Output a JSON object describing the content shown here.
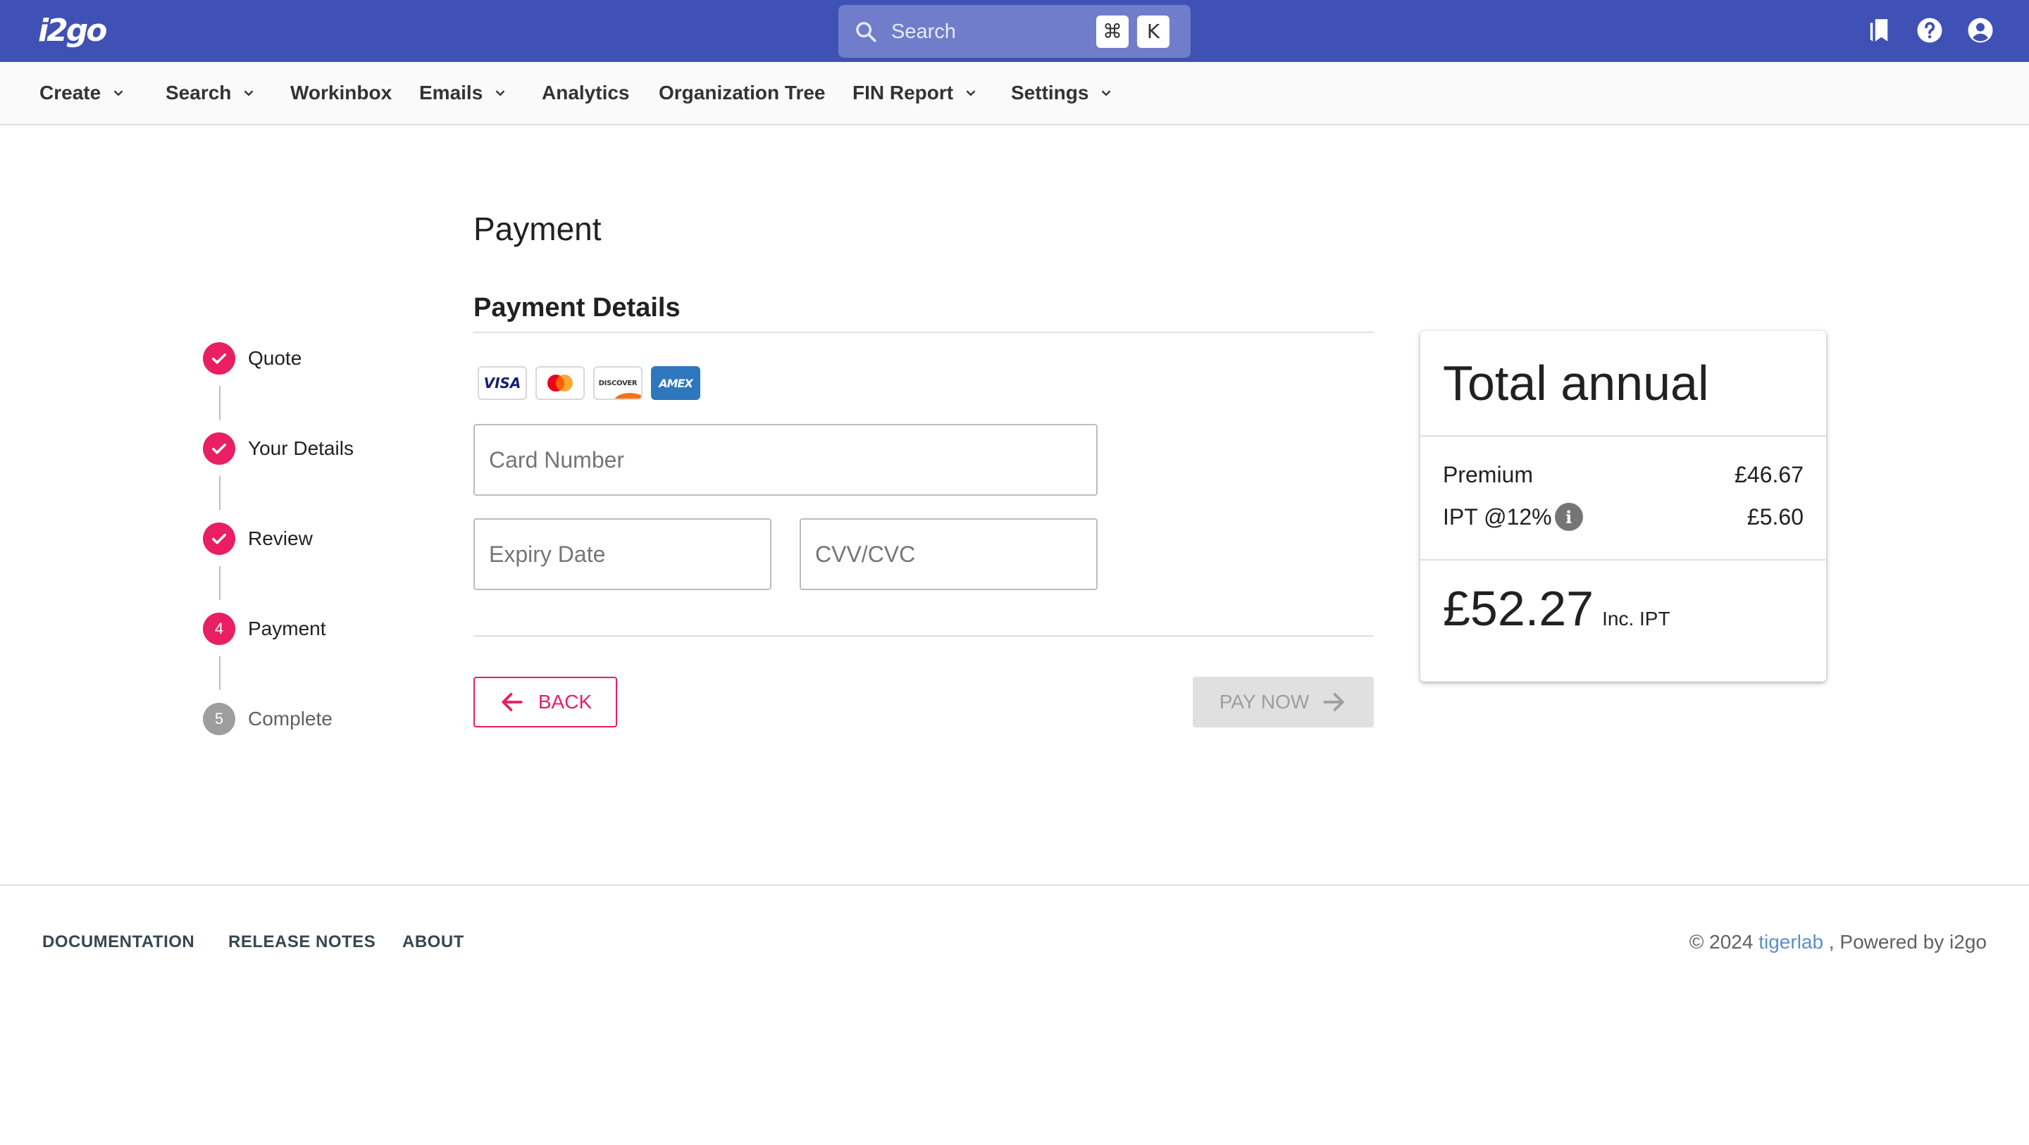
{
  "app": {
    "logo": "i2go"
  },
  "search": {
    "placeholder": "Search",
    "shortcut_cmd": "⌘",
    "shortcut_key": "K"
  },
  "menu": [
    {
      "label": "Create",
      "dropdown": true
    },
    {
      "label": "Search",
      "dropdown": true
    },
    {
      "label": "Workinbox",
      "dropdown": false
    },
    {
      "label": "Emails",
      "dropdown": true
    },
    {
      "label": "Analytics",
      "dropdown": false
    },
    {
      "label": "Organization Tree",
      "dropdown": false
    },
    {
      "label": "FIN Report",
      "dropdown": true
    },
    {
      "label": "Settings",
      "dropdown": true
    }
  ],
  "stepper": [
    {
      "label": "Quote",
      "state": "done"
    },
    {
      "label": "Your Details",
      "state": "done"
    },
    {
      "label": "Review",
      "state": "done"
    },
    {
      "label": "Payment",
      "number": "4",
      "state": "active"
    },
    {
      "label": "Complete",
      "number": "5",
      "state": "pending"
    }
  ],
  "main": {
    "title": "Payment",
    "section_title": "Payment Details",
    "card_brands": [
      "VISA",
      "Mastercard",
      "DISCOVER",
      "AMEX"
    ],
    "fields": {
      "card_number": {
        "placeholder": "Card Number",
        "value": ""
      },
      "expiry": {
        "placeholder": "Expiry Date",
        "value": ""
      },
      "cvv": {
        "placeholder": "CVV/CVC",
        "value": ""
      }
    },
    "back_label": "BACK",
    "pay_label": "PAY NOW"
  },
  "summary": {
    "title": "Total annual",
    "premium_label": "Premium",
    "premium_value": "£46.67",
    "ipt_label": "IPT @12%",
    "ipt_value": "£5.60",
    "total_value": "£52.27",
    "total_suffix": "Inc. IPT"
  },
  "footer": {
    "links": [
      "DOCUMENTATION",
      "RELEASE NOTES",
      "ABOUT"
    ],
    "copyright_prefix": "© 2024 ",
    "brand": "tigerlab",
    "copyright_suffix": " , Powered by i2go"
  },
  "colors": {
    "appbar": "#3f51b5",
    "accent": "#e91e63",
    "disabled": "#e0e0e0",
    "link": "#5c8fc9"
  }
}
